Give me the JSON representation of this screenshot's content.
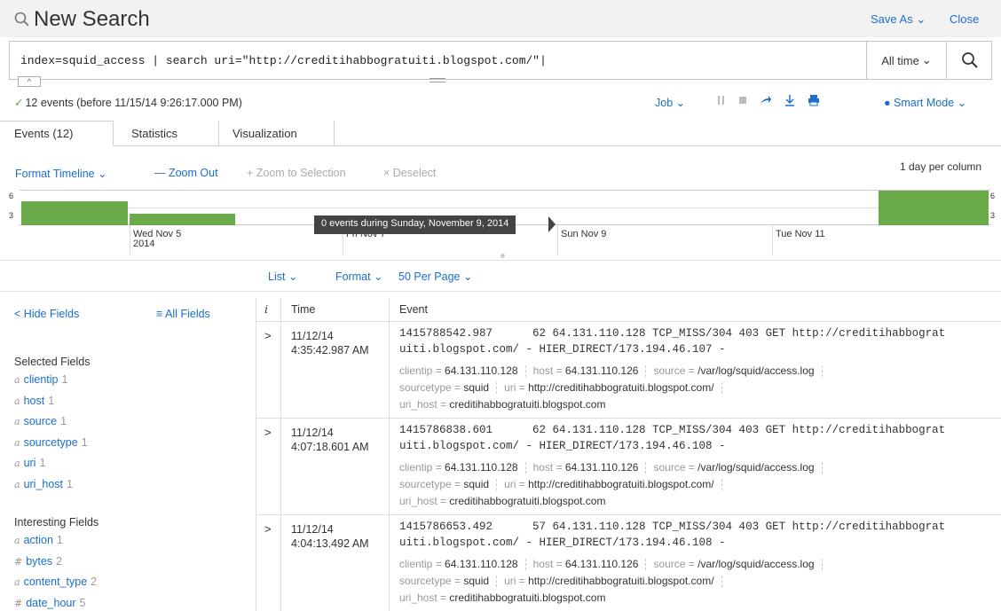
{
  "header": {
    "title": "New Search",
    "save_as": "Save As",
    "close": "Close"
  },
  "search": {
    "query": "index=squid_access | search uri=\"http://creditihabbogratuiti.blogspot.com/\"|",
    "time_range": "All time"
  },
  "status": {
    "summary": "12 events (before 11/15/14 9:26:17.000 PM)",
    "job": "Job",
    "mode": "Smart Mode"
  },
  "tabs": [
    {
      "label": "Events (12)"
    },
    {
      "label": "Statistics"
    },
    {
      "label": "Visualization"
    }
  ],
  "timeline": {
    "format_timeline": "Format Timeline",
    "zoom_out": "— Zoom Out",
    "zoom_to_selection": "+ Zoom to Selection",
    "deselect": "× Deselect",
    "scale_note": "1 day per column",
    "y_ticks": [
      "6",
      "3"
    ],
    "x_ticks": [
      {
        "line1": "Wed Nov 5",
        "line2": "2014"
      },
      {
        "line1": "Fri Nov 7",
        "line2": ""
      },
      {
        "line1": "Sun Nov 9",
        "line2": ""
      },
      {
        "line1": "Tue Nov 11",
        "line2": ""
      }
    ],
    "tooltip": "0 events during Sunday, November 9, 2014",
    "bars": [
      {
        "day": "Nov 4",
        "count": 4
      },
      {
        "day": "Nov 5",
        "count": 2
      },
      {
        "day": "Nov 12",
        "count": 6
      }
    ],
    "color": "#6aaa4a"
  },
  "list_controls": {
    "list": "List",
    "format": "Format",
    "per_page": "50 Per Page"
  },
  "sidebar": {
    "hide_fields": "Hide Fields",
    "all_fields": "All Fields",
    "selected_heading": "Selected Fields",
    "selected": [
      {
        "type": "a",
        "name": "clientip",
        "count": "1"
      },
      {
        "type": "a",
        "name": "host",
        "count": "1"
      },
      {
        "type": "a",
        "name": "source",
        "count": "1"
      },
      {
        "type": "a",
        "name": "sourcetype",
        "count": "1"
      },
      {
        "type": "a",
        "name": "uri",
        "count": "1"
      },
      {
        "type": "a",
        "name": "uri_host",
        "count": "1"
      }
    ],
    "interesting_heading": "Interesting Fields",
    "interesting": [
      {
        "type": "a",
        "name": "action",
        "count": "1"
      },
      {
        "type": "#",
        "name": "bytes",
        "count": "2"
      },
      {
        "type": "a",
        "name": "content_type",
        "count": "2"
      },
      {
        "type": "#",
        "name": "date_hour",
        "count": "5"
      }
    ]
  },
  "table": {
    "headers": {
      "info": "i",
      "time": "Time",
      "event": "Event"
    },
    "rows": [
      {
        "date": "11/12/14",
        "time": "4:35:42.987 AM",
        "raw1": "1415788542.987      62 64.131.110.128 TCP_MISS/304 403 GET http://creditihabbograt",
        "raw2": "uiti.blogspot.com/ - HIER_DIRECT/173.194.46.107 -",
        "clientip": "64.131.110.128",
        "host": "64.131.110.126",
        "source": "/var/log/squid/access.log",
        "sourcetype": "squid",
        "uri": "http://creditihabbogratuiti.blogspot.com/",
        "uri_host": "creditihabbogratuiti.blogspot.com"
      },
      {
        "date": "11/12/14",
        "time": "4:07:18.601 AM",
        "raw1": "1415786838.601      62 64.131.110.128 TCP_MISS/304 403 GET http://creditihabbograt",
        "raw2": "uiti.blogspot.com/ - HIER_DIRECT/173.194.46.108 -",
        "clientip": "64.131.110.128",
        "host": "64.131.110.126",
        "source": "/var/log/squid/access.log",
        "sourcetype": "squid",
        "uri": "http://creditihabbogratuiti.blogspot.com/",
        "uri_host": "creditihabbogratuiti.blogspot.com"
      },
      {
        "date": "11/12/14",
        "time": "4:04:13.492 AM",
        "raw1": "1415786653.492      57 64.131.110.128 TCP_MISS/304 403 GET http://creditihabbograt",
        "raw2": "uiti.blogspot.com/ - HIER_DIRECT/173.194.46.108 -",
        "clientip": "64.131.110.128",
        "host": "64.131.110.126",
        "source": "/var/log/squid/access.log",
        "sourcetype": "squid",
        "uri": "http://creditihabbogratuiti.blogspot.com/",
        "uri_host": "creditihabbogratuiti.blogspot.com"
      }
    ],
    "kv_labels": {
      "clientip": "clientip = ",
      "host": "host = ",
      "source": "source = ",
      "sourcetype": "sourcetype = ",
      "uri": "uri = ",
      "uri_host": "uri_host = "
    }
  },
  "colors": {
    "link": "#1a6fc9",
    "success": "#65a637",
    "bar": "#6aaa4a"
  }
}
